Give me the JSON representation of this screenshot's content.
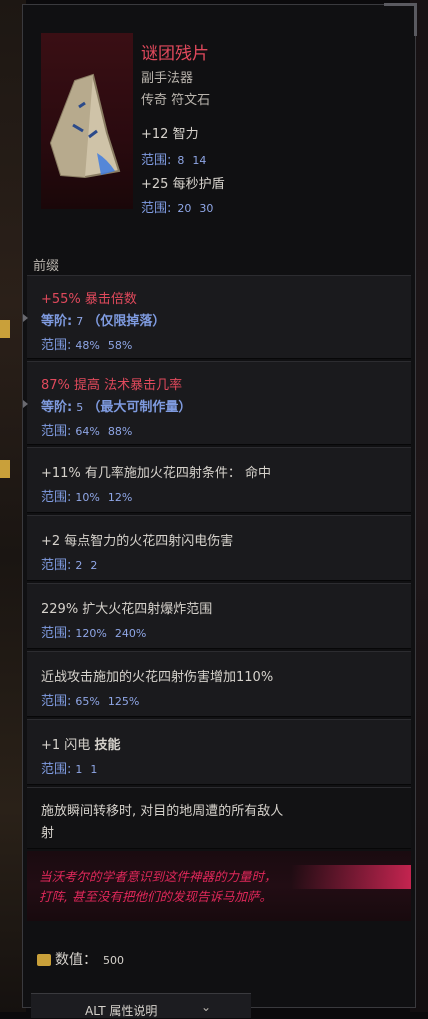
{
  "item": {
    "name": "谜团残片",
    "type": "副手法器",
    "rarity": "传奇 符文石",
    "implicits": [
      {
        "stat": "+12 智力",
        "range_label": "范围:",
        "min": "8",
        "max": "14"
      },
      {
        "stat": "+25 每秒护盾",
        "range_label": "范围:",
        "min": "20",
        "max": "30"
      }
    ],
    "icon": "rune-stone-shard-icon"
  },
  "prefix_label": "前缀",
  "affixes": [
    {
      "stat": "+55% 暴击倍数",
      "tier_label": "等阶:",
      "tier": "7",
      "tier_note": "（仅限掉落）",
      "range_label": "范围:",
      "min": "48%",
      "max": "58%",
      "color": "#e0495c"
    },
    {
      "stat": "87% 提高 法术暴击几率",
      "tier_label": "等阶:",
      "tier": "5",
      "tier_note": "（最大可制作量）",
      "range_label": "范围:",
      "min": "64%",
      "max": "88%",
      "color": "#e0495c"
    },
    {
      "stat": "+11% 有几率施加火花四射条件：  命中",
      "range_label": "范围:",
      "min": "10%",
      "max": "12%"
    },
    {
      "stat": "+2 每点智力的火花四射闪电伤害",
      "range_label": "范围:",
      "min": "2",
      "max": "2"
    },
    {
      "stat": "229% 扩大火花四射爆炸范围",
      "range_label": "范围:",
      "min": "120%",
      "max": "240%"
    },
    {
      "stat": "近战攻击施加的火花四射伤害增加110%",
      "range_label": "范围:",
      "min": "65%",
      "max": "125%"
    },
    {
      "stat_prefix": "+1 闪电 ",
      "stat_bold": "技能",
      "range_label": "范围:",
      "min": "1",
      "max": "1"
    }
  ],
  "special": {
    "line1": "施放瞬间转移时, 对目的地周遭的所有敌人",
    "line2": "射"
  },
  "lore": {
    "line1": "当沃考尔的学者意识到这件神器的力量时，",
    "line2": "打阵, 甚至没有把他们的发现告诉马加萨。"
  },
  "value": {
    "label": "数值：",
    "amount": "500",
    "icon": "coin-icon"
  },
  "alt": {
    "key": "ALT",
    "label": "属性说明",
    "chevron": "chevron-down-icon"
  },
  "colors": {
    "unique_red": "#e0495c",
    "range_blue": "#7f9be0",
    "lore_crimson": "#e0285a",
    "panel": "#101012"
  }
}
